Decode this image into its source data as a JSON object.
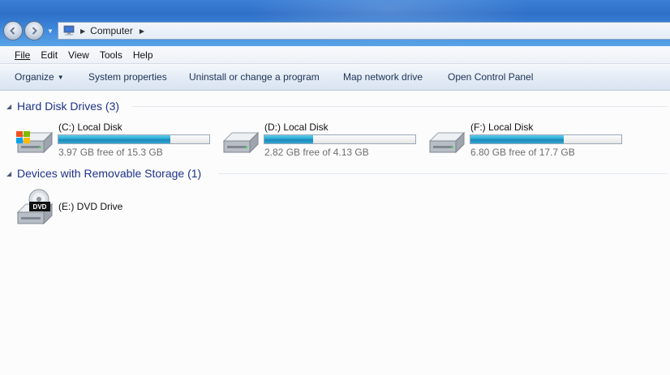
{
  "address": {
    "location": "Computer"
  },
  "icons": {
    "back": "back-arrow-icon",
    "forward": "forward-arrow-icon",
    "history": "chevron-down-icon",
    "computer": "computer-icon",
    "breadcrumb_separator": "chevron-right-icon",
    "hard_disk": "hard-disk-icon",
    "windows_disk": "windows-disk-icon",
    "dvd": "dvd-drive-icon"
  },
  "menu": {
    "file": "File",
    "edit": "Edit",
    "view": "View",
    "tools": "Tools",
    "help": "Help"
  },
  "commands": {
    "organize": "Organize",
    "system_properties": "System properties",
    "uninstall": "Uninstall or change a program",
    "map_network_drive": "Map network drive",
    "open_control_panel": "Open Control Panel"
  },
  "groups": {
    "hard_disks": {
      "title": "Hard Disk Drives (3)",
      "drives": [
        {
          "name": "(C:) Local Disk",
          "free_text": "3.97 GB free of 15.3 GB",
          "used_fraction": 0.74
        },
        {
          "name": "(D:) Local Disk",
          "free_text": "2.82 GB free of 4.13 GB",
          "used_fraction": 0.32
        },
        {
          "name": "(F:) Local Disk",
          "free_text": "6.80 GB free of 17.7 GB",
          "used_fraction": 0.62
        }
      ]
    },
    "removable": {
      "title": "Devices with Removable Storage (1)",
      "drives": [
        {
          "name": "(E:) DVD Drive",
          "badge": "DVD"
        }
      ]
    }
  },
  "colors": {
    "titlebar": "#2f6fc8",
    "group_header": "#1e3287",
    "bar_fill": "#27a6d0",
    "command_text": "#1e3355"
  }
}
